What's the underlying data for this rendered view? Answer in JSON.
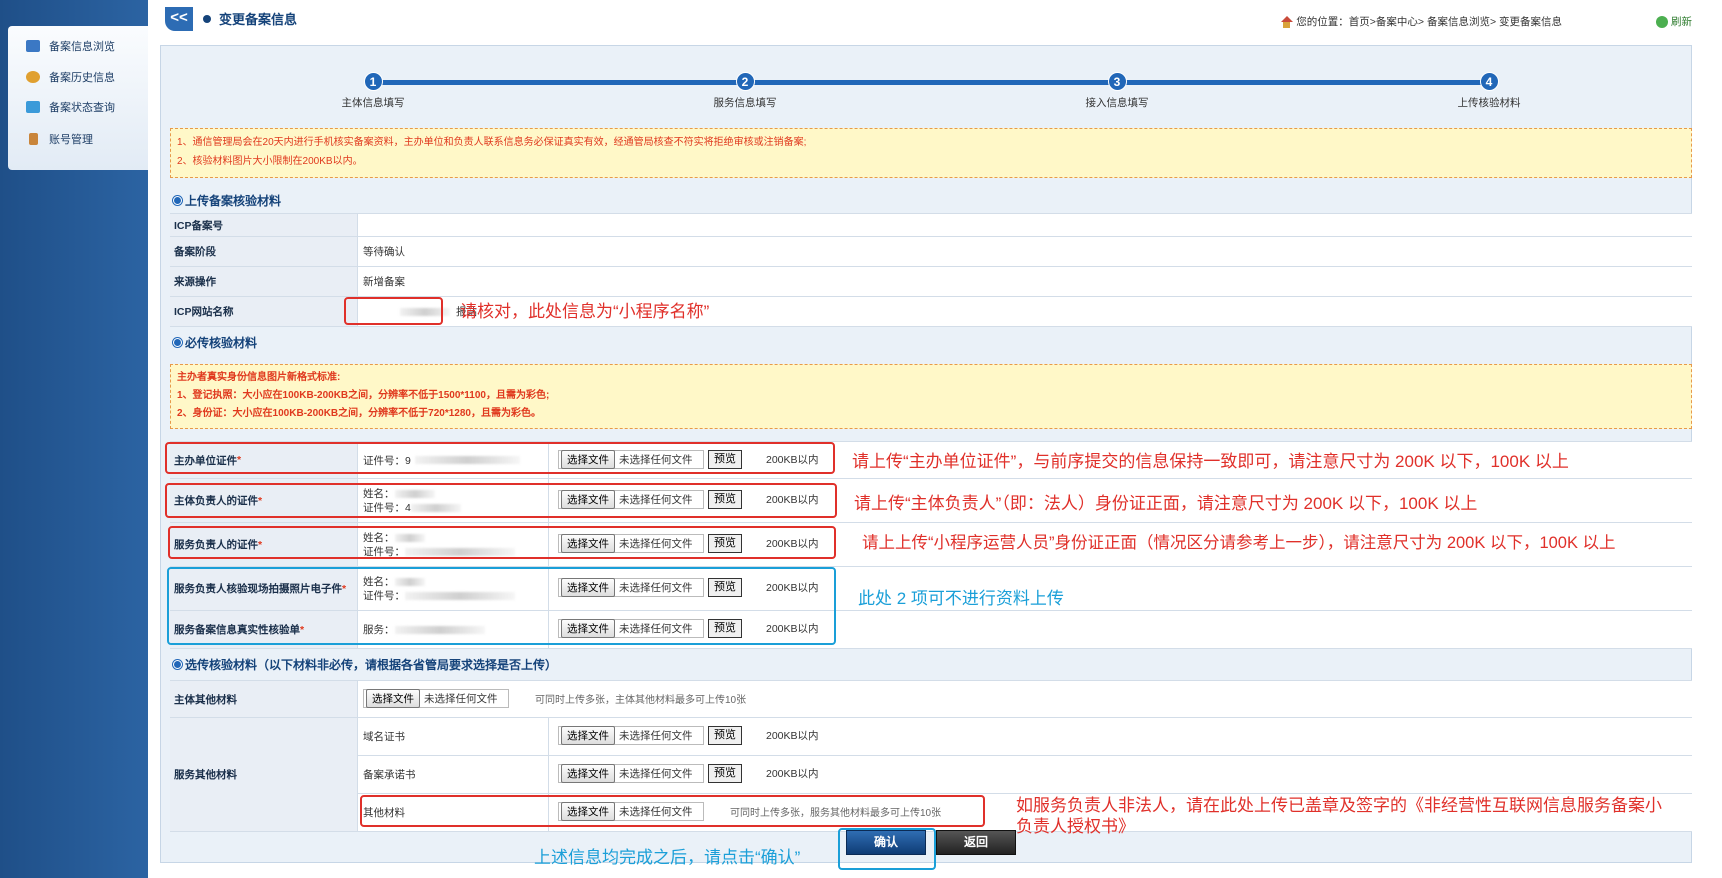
{
  "sidebar": {
    "items": [
      {
        "label": "备案信息浏览",
        "icon": "browse-icon",
        "color": "#3b78c4"
      },
      {
        "label": "备案历史信息",
        "icon": "history-icon",
        "color": "#e0a030"
      },
      {
        "label": "备案状态查询",
        "icon": "status-icon",
        "color": "#3b9ad9"
      },
      {
        "label": "账号管理",
        "icon": "account-icon",
        "color": "#c9853a"
      }
    ]
  },
  "header": {
    "collapse_glyph": "<<",
    "title": "变更备案信息",
    "breadcrumb": "您的位置：首页>备案中心> 备案信息浏览> 变更备案信息",
    "refresh": "刷新"
  },
  "steps": [
    {
      "num": "1",
      "label": "主体信息填写"
    },
    {
      "num": "2",
      "label": "服务信息填写"
    },
    {
      "num": "3",
      "label": "接入信息填写"
    },
    {
      "num": "4",
      "label": "上传核验材料"
    }
  ],
  "notice1": {
    "line1": "1、通信管理局会在20天内进行手机核实备案资料，主办单位和负责人联系信息务必保证真实有效，经通管局核查不符实将拒绝审核或注销备案;",
    "line2": "2、核验材料图片大小限制在200KB以内。"
  },
  "section_upload": "上传备案核验材料",
  "info_rows": [
    {
      "label": "ICP备案号",
      "value": ""
    },
    {
      "label": "备案阶段",
      "value": "等待确认"
    },
    {
      "label": "来源操作",
      "value": "新增备案"
    },
    {
      "label": "ICP网站名称",
      "value": "报站"
    }
  ],
  "section_required": "必传核验材料",
  "notice2": {
    "line0": "主办者真实身份信息图片新格式标准:",
    "line1": "1、登记执照：大小应在100KB-200KB之间，分辨率不低于1500*1100，且需为彩色;",
    "line2": "2、身份证：大小应在100KB-200KB之间，分辨率不低于720*1280，且需为彩色。"
  },
  "required_rows": [
    {
      "label": "主办单位证件",
      "req": "*",
      "line1": "证件号：9",
      "line2": "",
      "size": "200KB以内"
    },
    {
      "label": "主体负责人的证件",
      "req": "*",
      "line1": "姓名：",
      "line2": "证件号：4",
      "size": "200KB以内"
    },
    {
      "label": "服务负责人的证件",
      "req": "*",
      "line1": "姓名：",
      "line2": "证件号：",
      "size": "200KB以内"
    },
    {
      "label": "服务负责人核验现场拍摄照片电子件",
      "req": "*",
      "line1": "姓名：",
      "line2": "证件号：",
      "size": "200KB以内"
    },
    {
      "label": "服务备案信息真实性核验单",
      "req": "*",
      "line1": "服务：",
      "line2": "",
      "size": "200KB以内"
    }
  ],
  "file": {
    "choose": "选择文件",
    "none": "未选择任何文件",
    "preview": "预览"
  },
  "section_optional": "选传核验材料（以下材料非必传，请根据各省管局要求选择是否上传）",
  "optional": {
    "subject_label": "主体其他材料",
    "subject_hint": "可同时上传多张，主体其他材料最多可上传10张",
    "service_label": "服务其他材料",
    "service_rows": [
      {
        "label": "域名证书",
        "size": "200KB以内"
      },
      {
        "label": "备案承诺书",
        "size": "200KB以内"
      },
      {
        "label": "其他材料",
        "hint": "可同时上传多张，服务其他材料最多可上传10张"
      }
    ]
  },
  "buttons": {
    "confirm": "确认",
    "back": "返回"
  },
  "annotations": {
    "a1": "请核对，此处信息为“小程序名称”",
    "a2": "请上传“主办单位证件”，与前序提交的信息保持一致即可，请注意尺寸为 200K 以下，100K 以上",
    "a3": "请上传“主体负责人”（即：法人）身份证正面，请注意尺寸为 200K 以下，100K 以上",
    "a4": "请上上传“小程序运营人员”身份证正面（情况区分请参考上一步），请注意尺寸为 200K 以下，100K 以上",
    "a5": "此处 2 项可不进行资料上传",
    "a6_l1": "如服务负责人非法人，请在此处上传已盖章及签字的《非经营性互联网信息服务备案小",
    "a6_l2": "负责人授权书》",
    "a7": "上述信息均完成之后，请点击“确认”"
  },
  "colors": {
    "primary": "#2167b8",
    "annotation_red": "#e0302a",
    "annotation_blue": "#1a9fd8",
    "notice_bg": "#fff8c8"
  }
}
